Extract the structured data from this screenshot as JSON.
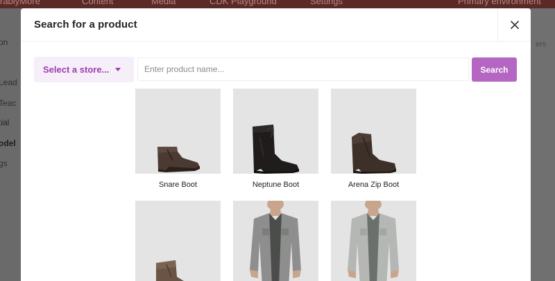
{
  "background": {
    "topbar_items": [
      "rablyMore",
      "Content",
      "Media",
      "CDK Playground",
      "Settings",
      "Primary environment"
    ],
    "sidebar_items": [
      "on",
      "Lead",
      "Teac",
      "tial",
      "odel",
      "gs"
    ],
    "right_fragment": "ers"
  },
  "modal": {
    "title": "Search for a product",
    "close_icon": "close-icon",
    "store_select_label": "Select a store...",
    "search_placeholder": "Enter product name...",
    "search_button_label": "Search"
  },
  "products": [
    {
      "name": "Snare Boot",
      "kind": "boot-brown"
    },
    {
      "name": "Neptune Boot",
      "kind": "boot-black"
    },
    {
      "name": "Arena Zip Boot",
      "kind": "boot-dark-brown"
    },
    {
      "name": "",
      "kind": "boot-light-brown"
    },
    {
      "name": "",
      "kind": "shirt-grey"
    },
    {
      "name": "",
      "kind": "shirt-light-grey"
    }
  ],
  "colors": {
    "accent": "#b566c2",
    "accent_text": "#9b3fad",
    "select_bg": "#f6eef8",
    "thumb_bg": "#e4e4e4"
  }
}
